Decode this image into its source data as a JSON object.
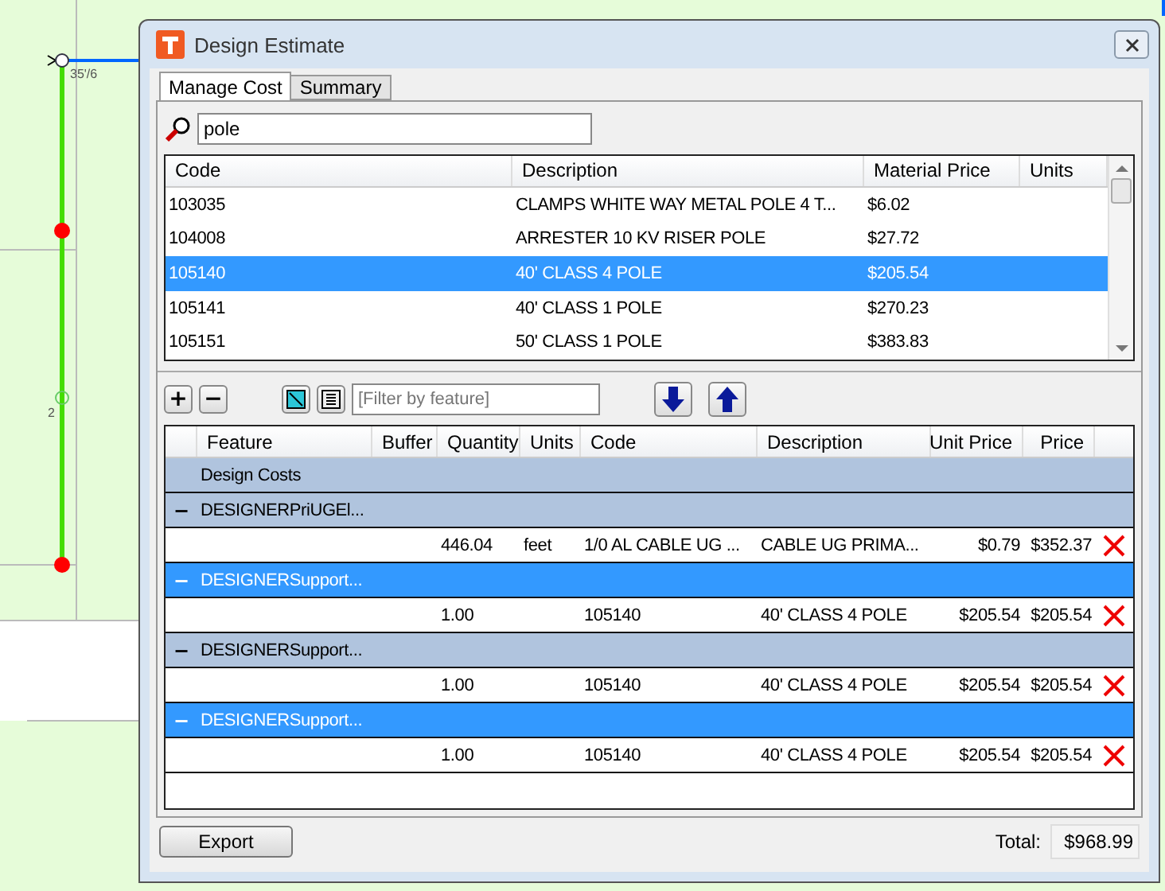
{
  "map": {
    "labels": [
      "35'/6",
      "2"
    ]
  },
  "window": {
    "title": "Design Estimate"
  },
  "tabs": [
    {
      "label": "Manage Cost",
      "selected": true
    },
    {
      "label": "Summary",
      "selected": false
    }
  ],
  "search": {
    "value": "pole"
  },
  "materials": {
    "columns": [
      "Code",
      "Description",
      "Material Price",
      "Units"
    ],
    "rows": [
      {
        "code": "103035",
        "description": "CLAMPS WHITE WAY METAL POLE 4 T...",
        "price": "$6.02",
        "selected": false
      },
      {
        "code": "104008",
        "description": "ARRESTER 10 KV RISER POLE",
        "price": "$27.72",
        "selected": false
      },
      {
        "code": "105140",
        "description": "40' CLASS 4 POLE",
        "price": "$205.54",
        "selected": true
      },
      {
        "code": "105141",
        "description": "40' CLASS 1 POLE",
        "price": "$270.23",
        "selected": false
      },
      {
        "code": "105151",
        "description": "50' CLASS 1 POLE",
        "price": "$383.83",
        "selected": false
      }
    ]
  },
  "toolbar": {
    "add": "+",
    "remove": "−",
    "filter_placeholder": "[Filter by feature]"
  },
  "estimate": {
    "columns": [
      "Feature",
      "Buffer",
      "Quantity",
      "Units",
      "Code",
      "Description",
      "Unit Price",
      "Price"
    ],
    "rows": [
      {
        "kind": "category",
        "label": "Design Costs"
      },
      {
        "kind": "group",
        "toggle": "−",
        "label": "DESIGNERPriUGEl...",
        "selected": false
      },
      {
        "kind": "item",
        "quantity": "446.04",
        "units": "feet",
        "code": "1/0 AL CABLE UG ...",
        "description": "CABLE UG PRIMA...",
        "unit_price": "$0.79",
        "price": "$352.37"
      },
      {
        "kind": "group",
        "toggle": "−",
        "label": "DESIGNERSupport...",
        "selected": true
      },
      {
        "kind": "item",
        "quantity": "1.00",
        "code": "105140",
        "description": "40' CLASS 4 POLE",
        "unit_price": "$205.54",
        "price": "$205.54"
      },
      {
        "kind": "group",
        "toggle": "−",
        "label": "DESIGNERSupport...",
        "selected": false
      },
      {
        "kind": "item",
        "quantity": "1.00",
        "code": "105140",
        "description": "40' CLASS 4 POLE",
        "unit_price": "$205.54",
        "price": "$205.54"
      },
      {
        "kind": "group",
        "toggle": "−",
        "label": "DESIGNERSupport...",
        "selected": true
      },
      {
        "kind": "item",
        "quantity": "1.00",
        "code": "105140",
        "description": "40' CLASS 4 POLE",
        "unit_price": "$205.54",
        "price": "$205.54"
      }
    ]
  },
  "footer": {
    "export": "Export",
    "total_label": "Total:",
    "total": "$968.99"
  }
}
